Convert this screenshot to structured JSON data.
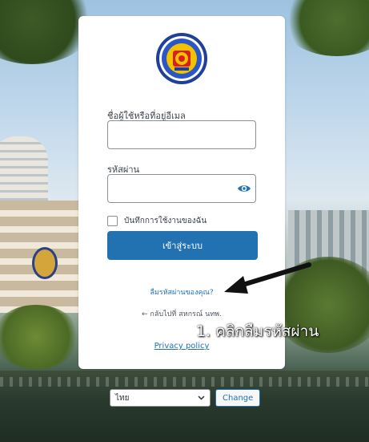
{
  "login": {
    "username_label": "ชื่อผู้ใช้หรือที่อยู่อีเมล",
    "username_value": "",
    "password_label": "รหัสผ่าน",
    "password_value": "",
    "remember_label": "บันทึกการใช้งานของฉัน",
    "submit_label": "เข้าสู่ระบบ",
    "lost_password": "ลืมรหัสผ่านของคุณ?",
    "back_link": "← กลับไปที่ สหกรณ์ นทพ.",
    "privacy_policy": "Privacy policy"
  },
  "annotation": {
    "text": "1. คลิกลืมรหัสผ่าน"
  },
  "language": {
    "selected": "ไทย",
    "change_label": "Change"
  },
  "icons": {
    "logo": "organization-seal-logo",
    "password_toggle": "eye-icon",
    "select_arrow": "chevron-down-icon",
    "annotation_arrow": "arrow-icon"
  },
  "colors": {
    "primary": "#2271b1",
    "card_bg": "#ffffff",
    "label_text": "#3c434a",
    "annotation_text": "#ffffff"
  }
}
